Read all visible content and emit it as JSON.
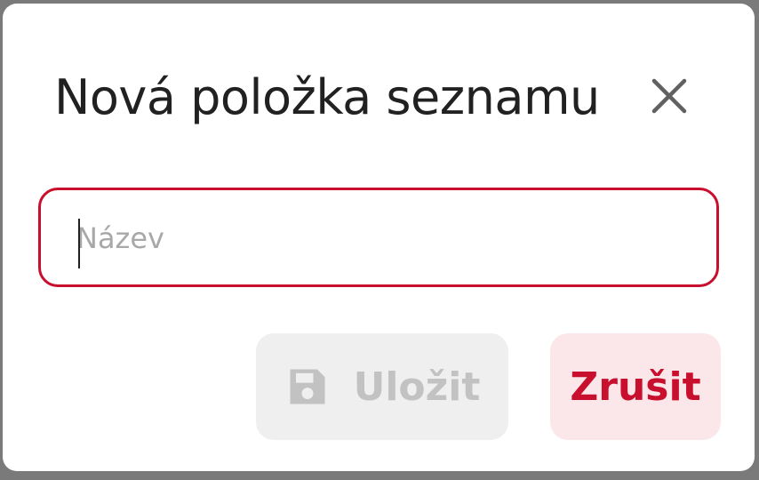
{
  "dialog": {
    "title": "Nová položka seznamu",
    "close_icon": "close-icon",
    "name_field": {
      "placeholder": "Název",
      "value": ""
    },
    "save_button": {
      "label": "Uložit",
      "icon": "floppy-disk-icon",
      "disabled": true
    },
    "cancel_button": {
      "label": "Zrušit"
    }
  },
  "colors": {
    "accent": "#c8102e",
    "cancel_bg": "#fbe7e9",
    "disabled_bg": "#efefef",
    "disabled_text": "#c2c2c2",
    "title_text": "#212121"
  }
}
